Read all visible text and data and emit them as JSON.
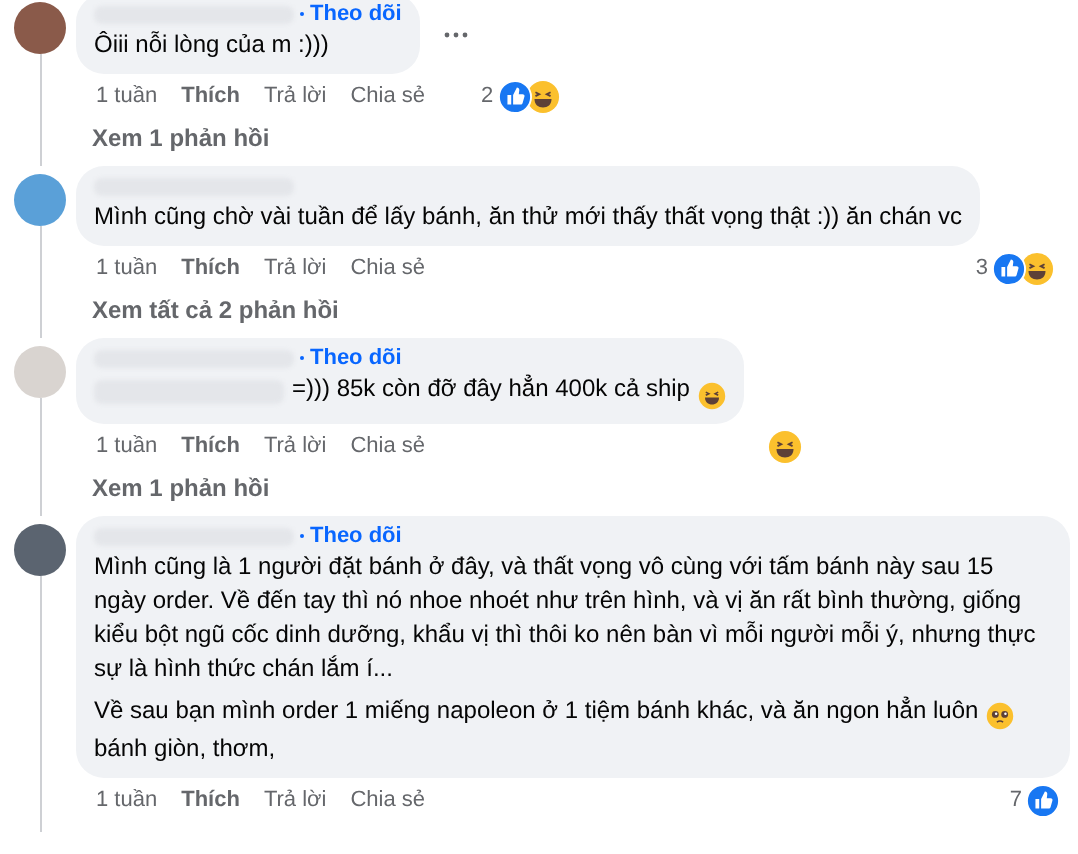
{
  "comments": [
    {
      "follow": "Theo dõi",
      "paragraphs": [
        {
          "text": "Ôiii nỗi lòng của m :)))"
        }
      ],
      "more": true,
      "time": "1 tuần",
      "like": "Thích",
      "reply": "Trả lời",
      "share": "Chia sẻ",
      "reaction_count": "2",
      "liked": true,
      "haha": true,
      "replies_link": "Xem 1 phản hồi"
    },
    {
      "paragraphs": [
        {
          "text": "Mình cũng chờ vài tuần để lấy bánh, ăn thử mới thấy thất vọng thật :)) ăn chán vc"
        }
      ],
      "time": "1 tuần",
      "like": "Thích",
      "reply": "Trả lời",
      "share": "Chia sẻ",
      "reaction_count": "3",
      "liked": true,
      "haha": true,
      "replies_link": "Xem tất cả 2 phản hồi"
    },
    {
      "follow": "Theo dõi",
      "paragraphs": [
        {
          "text": "=))) 85k còn đỡ đây hẳn 400k cả ship",
          "laugh_emoji": true,
          "blurred_start": true
        }
      ],
      "time": "1 tuần",
      "like": "Thích",
      "reply": "Trả lời",
      "share": "Chia sẻ",
      "haha": true,
      "replies_link": "Xem 1 phản hồi"
    },
    {
      "follow": "Theo dõi",
      "paragraphs": [
        {
          "text": "Mình cũng là 1 người đặt bánh ở đây, và thất vọng vô cùng với tấm bánh này sau 15 ngày order. Về đến tay thì nó nhoe nhoét như trên hình, và vị ăn rất bình thường, giống kiểu bột ngũ cốc dinh dưỡng, khẩu vị thì thôi ko nên bàn vì mỗi người mỗi ý, nhưng thực sự là hình thức chán lắm í..."
        },
        {
          "text": "Về sau bạn mình order 1 miếng napoleon ở 1 tiệm bánh khác, và ăn ngon hẳn luôn",
          "pleading_emoji": true,
          "after": "bánh giòn, thơm,"
        }
      ],
      "time": "1 tuần",
      "like": "Thích",
      "reply": "Trả lời",
      "share": "Chia sẻ",
      "reaction_count": "7",
      "liked": true
    }
  ]
}
